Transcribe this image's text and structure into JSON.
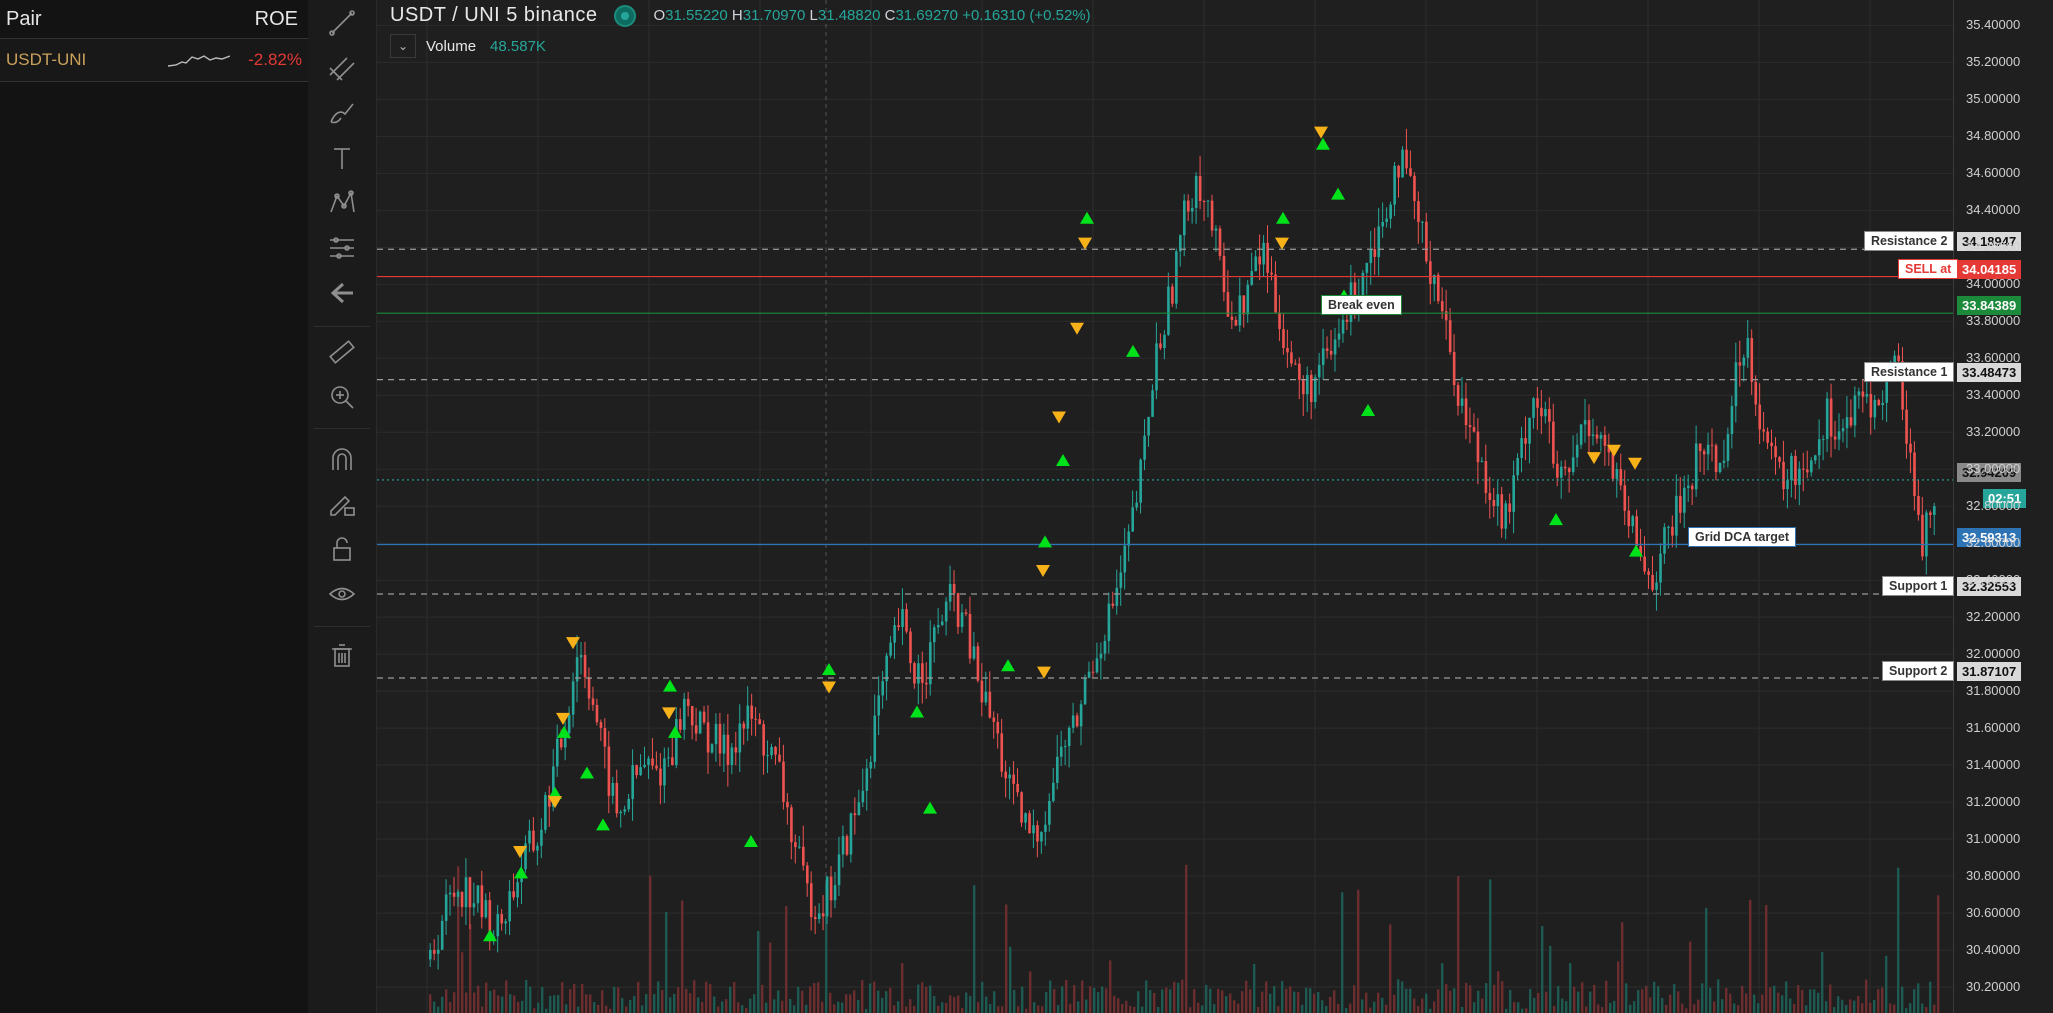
{
  "sidebar": {
    "pair_header": "Pair",
    "roe_header": "ROE",
    "rows": [
      {
        "pair": "USDT-UNI",
        "roe": "-2.82%"
      }
    ]
  },
  "toolbar": {
    "tools": [
      "trend-line-icon",
      "parallel-lines-icon",
      "brush-icon",
      "text-icon",
      "pattern-icon",
      "measure-lines-icon",
      "back-arrow-icon",
      "ruler-icon",
      "zoom-in-icon",
      "magnet-icon",
      "lock-drawing-icon",
      "unlock-icon",
      "eye-icon",
      "trash-icon"
    ]
  },
  "legend": {
    "title": "USDT / UNI  5  binance",
    "open_label": "O",
    "open": "31.55220",
    "high_label": "H",
    "high": "31.70970",
    "low_label": "L",
    "low": "31.48820",
    "close_label": "C",
    "close": "31.69270",
    "change": "+0.16310 (+0.52%)",
    "volume_label": "Volume",
    "volume": "48.587K"
  },
  "axis": {
    "ticks": [
      "35.40000",
      "35.20000",
      "35.00000",
      "34.80000",
      "34.60000",
      "34.40000",
      "34.20000",
      "34.00000",
      "33.80000",
      "33.60000",
      "33.40000",
      "33.20000",
      "33.00000",
      "32.80000",
      "32.60000",
      "32.40000",
      "32.20000",
      "32.00000",
      "31.80000",
      "31.60000",
      "31.40000",
      "31.20000",
      "31.00000",
      "30.80000",
      "30.60000",
      "30.40000",
      "30.20000"
    ],
    "countdown": "02:51",
    "last_price": "32.94209"
  },
  "levels": {
    "resistance2": {
      "label": "Resistance 2",
      "price": "34.18947"
    },
    "sell": {
      "label": "SELL at",
      "price": "34.04185"
    },
    "break_even": {
      "label": "Break even",
      "price": "33.84389"
    },
    "resistance1": {
      "label": "Resistance 1",
      "price": "33.48473"
    },
    "grid_dca": {
      "label": "Grid DCA target",
      "price": "32.59313"
    },
    "support1": {
      "label": "Support 1",
      "price": "32.32553"
    },
    "support2": {
      "label": "Support 2",
      "price": "31.87107"
    }
  },
  "colors": {
    "up": "#26a69a",
    "down": "#ef5350",
    "sell": "#e53935",
    "break_even": "#1b8a3a",
    "grid": "#2e74b5",
    "buy_marker": "#00e21a",
    "sell_marker": "#f7b21a"
  },
  "chart_data": {
    "type": "candlestick",
    "ylim": [
      30.1,
      35.45
    ],
    "close_path": [
      30.35,
      30.6,
      30.75,
      30.72,
      30.6,
      30.5,
      30.7,
      30.9,
      31.0,
      31.3,
      31.6,
      32.05,
      31.8,
      31.4,
      31.1,
      31.3,
      31.4,
      31.35,
      31.5,
      31.75,
      31.6,
      31.55,
      31.45,
      31.6,
      31.65,
      31.5,
      31.35,
      31.0,
      30.7,
      30.65,
      30.75,
      31.0,
      31.2,
      31.6,
      31.9,
      32.2,
      31.9,
      31.95,
      32.2,
      32.3,
      32.1,
      31.8,
      31.6,
      31.3,
      31.1,
      31.0,
      31.2,
      31.5,
      31.6,
      31.9,
      32.1,
      32.3,
      32.6,
      33.0,
      33.6,
      33.9,
      34.3,
      34.6,
      34.4,
      34.0,
      33.8,
      34.0,
      34.2,
      33.9,
      33.6,
      33.4,
      33.5,
      33.6,
      33.8,
      34.0,
      34.2,
      34.35,
      34.7,
      34.5,
      34.2,
      34.0,
      33.6,
      33.3,
      33.1,
      32.9,
      32.7,
      33.0,
      33.4,
      33.3,
      32.9,
      33.0,
      33.3,
      33.2,
      33.0,
      32.75,
      32.55,
      32.4,
      32.6,
      32.8,
      33.0,
      33.15,
      33.0,
      33.4,
      33.75,
      33.3,
      33.0,
      32.95,
      33.0,
      33.1,
      33.3,
      33.2,
      33.3,
      33.4,
      33.3,
      33.65,
      33.2,
      32.6,
      32.8
    ],
    "buy_markers": 24,
    "sell_markers": 16
  }
}
